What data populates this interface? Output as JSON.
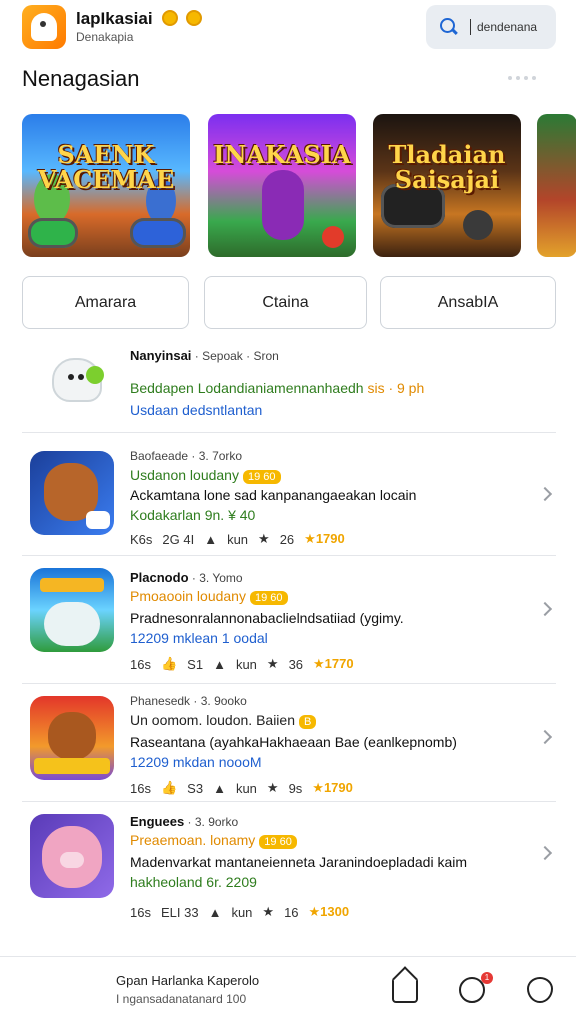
{
  "header": {
    "title": "lapIkasiai",
    "subtitle": "Denakapia",
    "search_text": "dendenana"
  },
  "section": {
    "title": "Nenagasian"
  },
  "featured": [
    {
      "name": "SAENK VACEMAE",
      "sub": ""
    },
    {
      "name": "INAKASIA",
      "sub": ""
    },
    {
      "name": "Tladaian Saisajai",
      "sub": ""
    }
  ],
  "filters": [
    "Amarara",
    "Ctaina",
    "AnsabIA"
  ],
  "list": [
    {
      "name": "Nanyinsai",
      "meta": "· Sepoak · Sron",
      "tagline": "Beddapen Lodandianiamennanhaedh",
      "tagline_orange": "sis · 9 ph",
      "extra": "Usdaan dedsntlantan",
      "extra_class": "blue"
    },
    {
      "name": "Baofaeade",
      "meta": "· 3. 7orko",
      "tagline": "Usdanon loudany",
      "badge": "19 60",
      "desc": "Ackamtana lone sad kanpanangaeakan locain",
      "extra": "Kodakarlan 9n. ¥ 40",
      "stats": [
        "K6s",
        "2G 4I",
        "kun",
        "26",
        "★1790"
      ]
    },
    {
      "name": "Placnodo",
      "meta": "· 3. Yomo",
      "tagline": "Pmoaooin loudany",
      "badge": "19 60",
      "desc": "Pradnesonralannonabaclielndsatiiad (ygimy.",
      "extra": "12209 mklean 1 oodal",
      "stats": [
        "16s",
        "S1",
        "kun",
        "36",
        "★1770"
      ]
    },
    {
      "name": "Phanesedk",
      "meta": "· 3. 9ooko",
      "tagline": "Un oomom. loudon. Baiien",
      "badge": "B",
      "desc": "Raseantana (ayahkaHakhaeaan Bae (eanlkepnomb)",
      "extra": "12209 mkdan noooM",
      "stats": [
        "16s",
        "S3",
        "kun",
        "9s",
        "★1790"
      ]
    },
    {
      "name": "Enguees",
      "meta": "· 3. 9orko",
      "tagline": "Preaemoan. lonamy",
      "badge": "19 60",
      "desc": "Madenvarkat mantaneienneta Jaranindoepladadi kaim",
      "extra": "hakheoland 6r. 2209",
      "stats": [
        "16s",
        "ELI 33",
        "kun",
        "16",
        "★1300"
      ]
    }
  ],
  "bottom": {
    "title": "Gpan Harlanka Kaperolo",
    "sub": "I ngansadanatanard 100",
    "badge_count": "1"
  }
}
